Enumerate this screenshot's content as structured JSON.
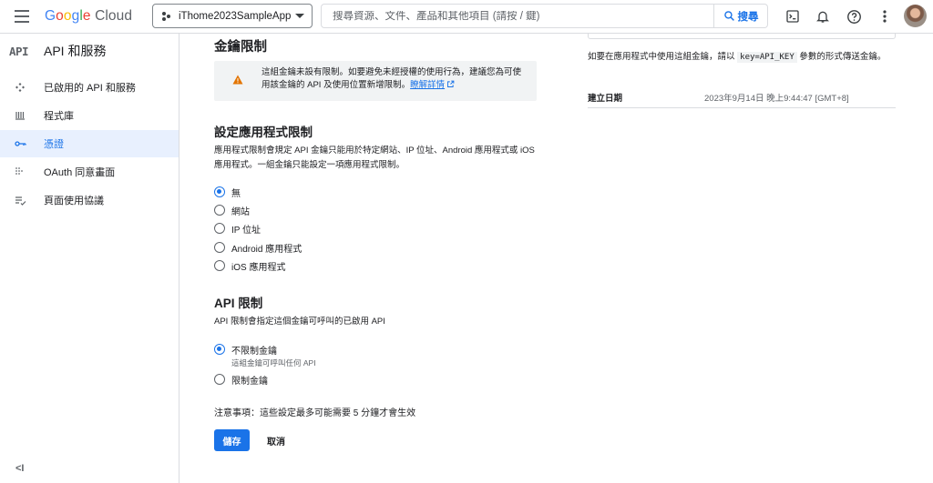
{
  "topbar": {
    "logo": {
      "g": "G",
      "o1": "o",
      "o2": "o",
      "g2": "g",
      "l": "l",
      "e": "e",
      "cloud": "Cloud"
    },
    "project": "iThome2023SampleApp",
    "search_placeholder": "搜尋資源、文件、產品和其他項目 (請按 / 鍵)",
    "search_button": "搜尋"
  },
  "sidebar": {
    "glyph": "API",
    "title": "API 和服務",
    "items": [
      {
        "label": "已啟用的 API 和服務",
        "icon": "apis-icon"
      },
      {
        "label": "程式庫",
        "icon": "library-icon"
      },
      {
        "label": "憑證",
        "icon": "key-icon",
        "active": true
      },
      {
        "label": "OAuth 同意畫面",
        "icon": "consent-icon"
      },
      {
        "label": "頁面使用協議",
        "icon": "agreements-icon"
      }
    ],
    "collapse": "<I"
  },
  "main": {
    "key_restrictions_title": "金鑰限制",
    "warning": {
      "text": "這組金鑰未設有限制。如要避免未經授權的使用行為，建議您為可使用該金鑰的 API 及使用位置新增限制。",
      "link": "瞭解詳情"
    },
    "app_restrictions": {
      "title": "設定應用程式限制",
      "desc": "應用程式限制會規定 API 金鑰只能用於特定網站、IP 位址、Android 應用程式或 iOS 應用程式。一組金鑰只能設定一項應用程式限制。",
      "options": [
        "無",
        "網站",
        "IP 位址",
        "Android 應用程式",
        "iOS 應用程式"
      ],
      "selected": "無"
    },
    "api_restrictions": {
      "title": "API 限制",
      "desc": "API 限制會指定這個金鑰可呼叫的已啟用 API",
      "options": [
        {
          "label": "不限制金鑰",
          "sub": "這組金鑰可呼叫任何 API"
        },
        {
          "label": "限制金鑰",
          "sub": ""
        }
      ],
      "selected": "不限制金鑰"
    },
    "note": "注意事項：這些設定最多可能需要 5 分鐘才會生效",
    "save": "儲存",
    "cancel": "取消"
  },
  "right": {
    "desc_before": "如要在應用程式中使用這組金鑰，請以",
    "code": "key=API_KEY",
    "desc_after": "參數的形式傳送金鑰。",
    "created_label": "建立日期",
    "created_value": "2023年9月14日 晚上9:44:47 [GMT+8]"
  },
  "colors": {
    "accent": "#1a73e8",
    "warning": "#e37400",
    "active_bg": "#e8f0fe"
  }
}
